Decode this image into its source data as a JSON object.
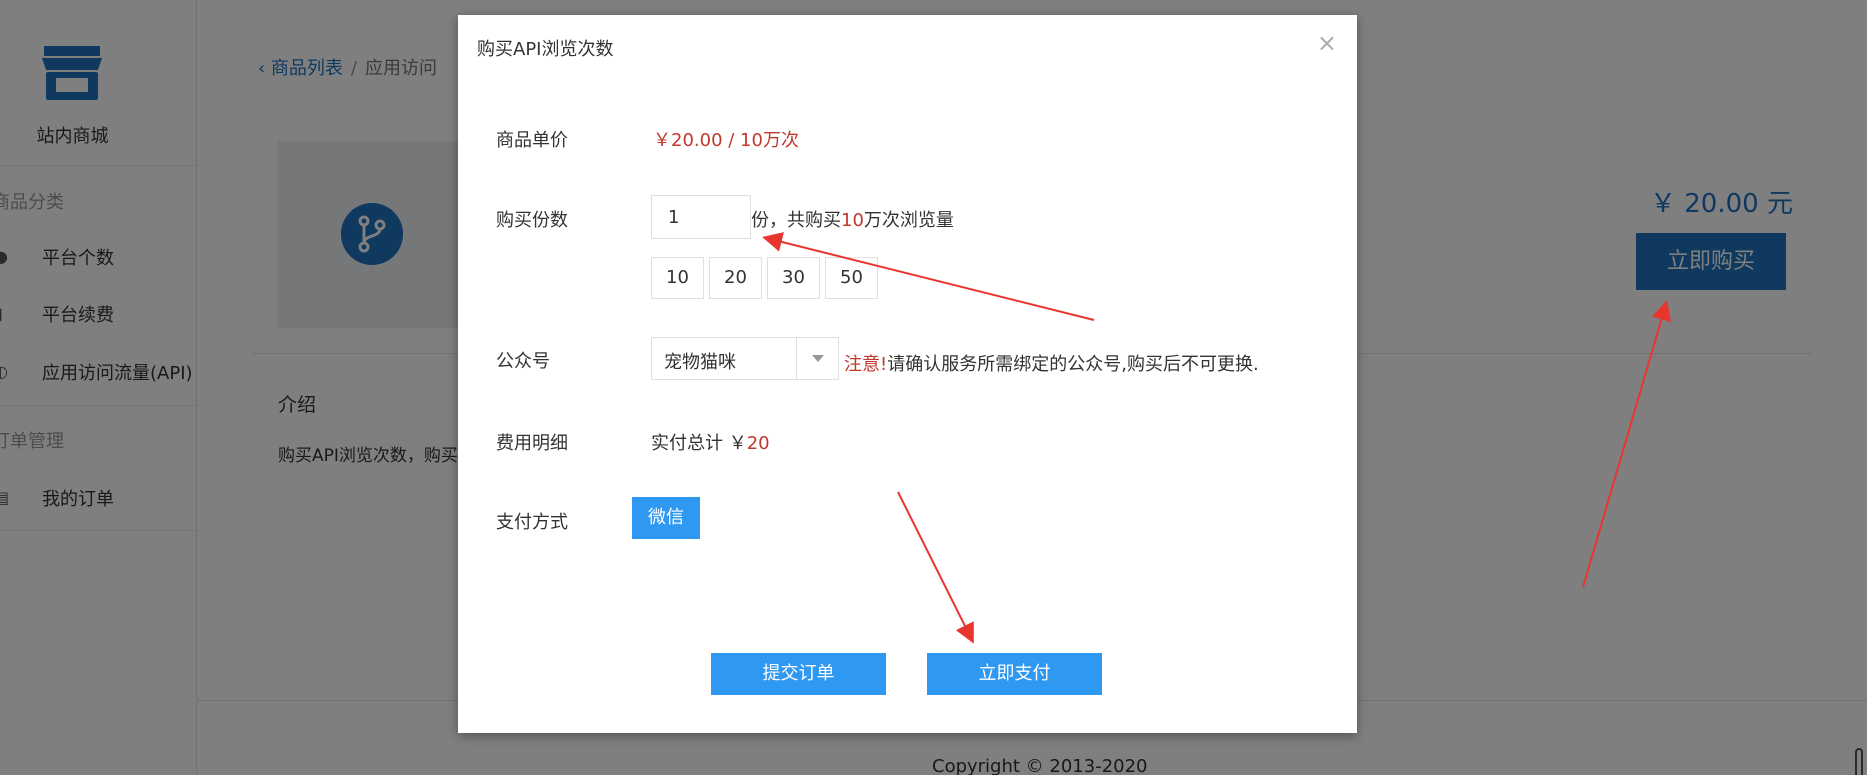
{
  "sidebar": {
    "brand": "站内商城",
    "section_category": "商品分类",
    "items_category": [
      {
        "label": "平台个数",
        "icon": "wechat-icon"
      },
      {
        "label": "平台续费",
        "icon": "lock-icon"
      },
      {
        "label": "应用访问流量(API)",
        "icon": "gauge-icon"
      }
    ],
    "section_orders": "订单管理",
    "items_orders": [
      {
        "label": "我的订单",
        "icon": "receipt-icon"
      }
    ]
  },
  "breadcrumb": {
    "back": "商品列表",
    "separator": "/",
    "current": "应用访问"
  },
  "product": {
    "price": "￥ 20.00 元",
    "buy_label": "立即购买",
    "intro_title": "介绍",
    "intro_text": "购买API浏览次数，购买"
  },
  "footer": {
    "copyright": "Copyright © 2013-2020"
  },
  "modal": {
    "title": "购买API浏览次数",
    "close": "×",
    "unit_price_label": "商品单价",
    "unit_price_value": "￥20.00 / 10万次",
    "quantity_label": "购买份数",
    "quantity_value": "1",
    "quantity_suffix_pre": "份，共购买",
    "quantity_amount": "10",
    "quantity_suffix_post": "万次浏览量",
    "quantity_options": [
      "10",
      "20",
      "30",
      "50"
    ],
    "account_label": "公众号",
    "account_value": "宠物猫咪",
    "notice_warn": "注意!",
    "notice_text": "请确认服务所需绑定的公众号,购买后不可更换.",
    "fee_label": "费用明细",
    "fee_prefix": "实付总计 ￥",
    "fee_value": "20",
    "payment_label": "支付方式",
    "payment_method": "微信",
    "submit_label": "提交订单",
    "pay_now_label": "立即支付"
  },
  "colors": {
    "brand_blue": "#1e73be",
    "button_blue": "#2f98f0",
    "price_red": "#c0392b",
    "annotation_red": "#e8352e"
  }
}
